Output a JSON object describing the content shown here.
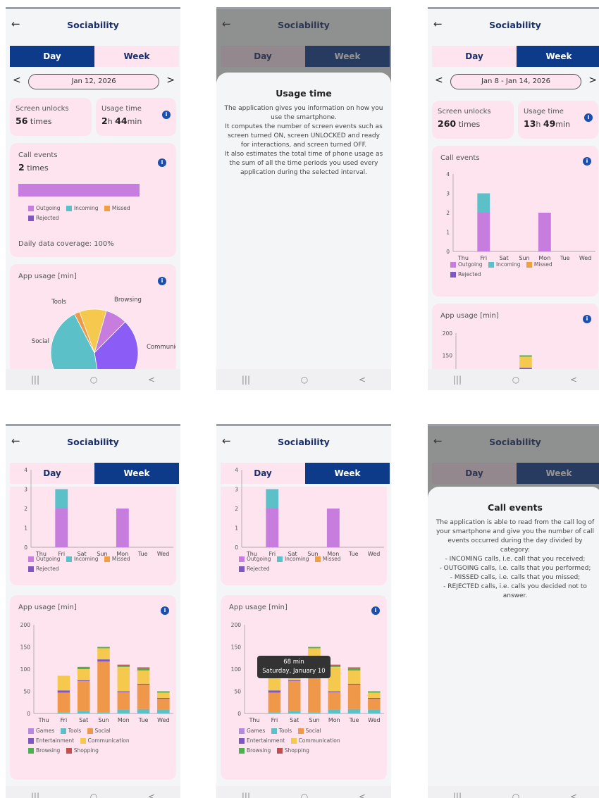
{
  "common": {
    "title": "Sociability",
    "tab_day": "Day",
    "tab_week": "Week",
    "back_icon": "←",
    "info_glyph": "i",
    "nav_recent": "|||",
    "nav_home": "○",
    "nav_back": "<"
  },
  "screen1": {
    "date": "Jan 12, 2026",
    "unlocks_label": "Screen unlocks",
    "unlocks_value": "56",
    "unlocks_unit": "times",
    "usage_label": "Usage time",
    "usage_h": "2",
    "usage_min": "44",
    "call_label": "Call events",
    "call_value": "2",
    "call_unit": "times",
    "legend": [
      "Outgoing",
      "Incoming",
      "Missed",
      "Rejected"
    ],
    "coverage": "Daily data coverage: 100%",
    "app_label": "App usage [min]",
    "pie_labels": [
      "Tools",
      "Browsing",
      "Social",
      "Communic..."
    ]
  },
  "screen2": {
    "sheet_title": "Usage time",
    "sheet_text": "The application gives you information on how you use the smartphone.\nIt computes the number of screen events such as screen turned ON, screen UNLOCKED and ready for interactions, and screen turned OFF.\nIt also estimates the total time of phone usage as the sum of all the time periods you used every application during the selected interval."
  },
  "screen3": {
    "date": "Jan 8 - Jan 14, 2026",
    "unlocks_label": "Screen unlocks",
    "unlocks_value": "260",
    "unlocks_unit": "times",
    "usage_label": "Usage time",
    "usage_h": "13",
    "usage_min": "49",
    "call_label": "Call events",
    "app_label": "App usage [min]",
    "legend": [
      "Outgoing",
      "Incoming",
      "Missed",
      "Rejected"
    ]
  },
  "screen5": {
    "tooltip_value": "68 min",
    "tooltip_date": "Saturday, January 10"
  },
  "screen6": {
    "sheet_title": "Call events",
    "sheet_text": "The application is able to read from the call log of your smartphone and give you the number of call events occurred during the day divided by category:\n- INCOMING calls, i.e. call that you received;\n- OUTGOING calls, i.e. calls that you performed;\n- MISSED calls, i.e. calls that you missed;\n- REJECTED calls, i.e. calls you decided not to answer."
  },
  "app_legend": [
    "Games",
    "Tools",
    "Social",
    "Entertainment",
    "Communication",
    "Browsing",
    "Shopping"
  ],
  "colors": {
    "primary": "#0d3b8a",
    "card": "#fde4ef",
    "outgoing": "#c77dde",
    "incoming": "#5bc0c8",
    "missed": "#f0a040",
    "rejected": "#7e57c2",
    "games": "#b48ae0",
    "tools": "#5bc0c8",
    "social": "#f0984a",
    "entertainment": "#7e57c2",
    "communication": "#f5c94e",
    "browsing": "#4caf50",
    "shopping": "#c0504d"
  },
  "chart_data": [
    {
      "type": "bar",
      "title": "Call events",
      "categories": [
        "Thu",
        "Fri",
        "Sat",
        "Sun",
        "Mon",
        "Tue",
        "Wed"
      ],
      "ylim": [
        0,
        4
      ],
      "yticks": [
        0,
        1,
        2,
        3,
        4
      ],
      "series": [
        {
          "name": "Outgoing",
          "values": [
            0,
            2,
            0,
            0,
            2,
            0,
            0
          ]
        },
        {
          "name": "Incoming",
          "values": [
            0,
            1,
            0,
            0,
            0,
            0,
            0
          ]
        },
        {
          "name": "Missed",
          "values": [
            0,
            0,
            0,
            0,
            0,
            0,
            0
          ]
        },
        {
          "name": "Rejected",
          "values": [
            0,
            0,
            0,
            0,
            0,
            0,
            0
          ]
        }
      ]
    },
    {
      "type": "bar",
      "title": "App usage [min]",
      "categories": [
        "Thu",
        "Fri",
        "Sat",
        "Sun",
        "Mon",
        "Tue",
        "Wed"
      ],
      "ylim": [
        0,
        200
      ],
      "yticks": [
        0,
        50,
        100,
        150,
        200
      ],
      "series": [
        {
          "name": "Tools",
          "values": [
            0,
            2,
            5,
            2,
            8,
            10,
            8
          ]
        },
        {
          "name": "Social",
          "values": [
            0,
            45,
            68,
            115,
            40,
            55,
            25
          ]
        },
        {
          "name": "Entertainment",
          "values": [
            0,
            5,
            2,
            5,
            2,
            2,
            2
          ]
        },
        {
          "name": "Communication",
          "values": [
            0,
            33,
            25,
            25,
            55,
            30,
            12
          ]
        },
        {
          "name": "Browsing",
          "values": [
            0,
            0,
            5,
            3,
            3,
            5,
            3
          ]
        },
        {
          "name": "Shopping",
          "values": [
            0,
            0,
            0,
            0,
            2,
            2,
            0
          ]
        }
      ]
    },
    {
      "type": "pie",
      "title": "App usage [min]",
      "categories": [
        "Tools",
        "Browsing",
        "Social",
        "Communication",
        "Games"
      ],
      "values": [
        10,
        8,
        35,
        45,
        2
      ]
    }
  ]
}
